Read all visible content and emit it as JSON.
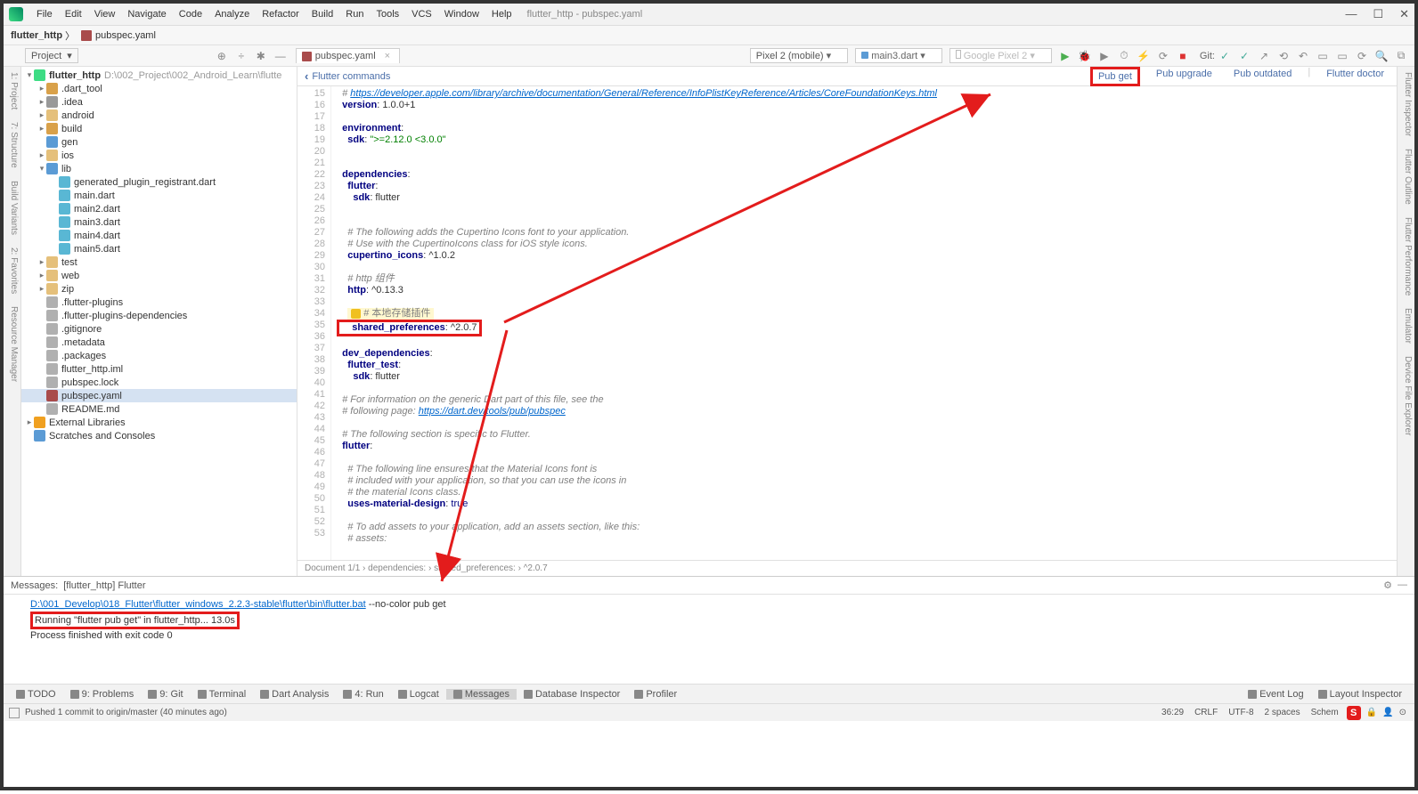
{
  "window": {
    "doc_title": "flutter_http - pubspec.yaml"
  },
  "menu": [
    "File",
    "Edit",
    "View",
    "Navigate",
    "Code",
    "Analyze",
    "Refactor",
    "Build",
    "Run",
    "Tools",
    "VCS",
    "Window",
    "Help"
  ],
  "breadcrumbs": {
    "root": "flutter_http",
    "file": "pubspec.yaml"
  },
  "toolbar": {
    "project_label": "Project",
    "device": "Pixel 2 (mobile)",
    "config": "main3.dart",
    "device2": "Google Pixel 2",
    "git_label": "Git:"
  },
  "left_rail": [
    "1: Project",
    "7: Structure",
    "Build Variants",
    "2: Favorites",
    "Resource Manager"
  ],
  "right_rail": [
    "Flutter Inspector",
    "Flutter Outline",
    "Flutter Performance",
    "Emulator",
    "Device File Explorer"
  ],
  "tree": {
    "root": {
      "name": "flutter_http",
      "path": "D:\\002_Project\\002_Android_Learn\\flutte"
    },
    "items": [
      {
        "d": 1,
        "e": "▸",
        "ic": "ic-folder-o",
        "name": ".dart_tool"
      },
      {
        "d": 1,
        "e": "▸",
        "ic": "ic-folder-g",
        "name": ".idea"
      },
      {
        "d": 1,
        "e": "▸",
        "ic": "ic-folder",
        "name": "android"
      },
      {
        "d": 1,
        "e": "▸",
        "ic": "ic-folder-o",
        "name": "build"
      },
      {
        "d": 1,
        "e": "",
        "ic": "ic-folder-b",
        "name": "gen"
      },
      {
        "d": 1,
        "e": "▸",
        "ic": "ic-folder",
        "name": "ios"
      },
      {
        "d": 1,
        "e": "▾",
        "ic": "ic-folder-b",
        "name": "lib"
      },
      {
        "d": 2,
        "e": "",
        "ic": "ic-dart",
        "name": "generated_plugin_registrant.dart"
      },
      {
        "d": 2,
        "e": "",
        "ic": "ic-dart",
        "name": "main.dart"
      },
      {
        "d": 2,
        "e": "",
        "ic": "ic-dart",
        "name": "main2.dart"
      },
      {
        "d": 2,
        "e": "",
        "ic": "ic-dart",
        "name": "main3.dart"
      },
      {
        "d": 2,
        "e": "",
        "ic": "ic-dart",
        "name": "main4.dart"
      },
      {
        "d": 2,
        "e": "",
        "ic": "ic-dart",
        "name": "main5.dart"
      },
      {
        "d": 1,
        "e": "▸",
        "ic": "ic-folder",
        "name": "test"
      },
      {
        "d": 1,
        "e": "▸",
        "ic": "ic-folder",
        "name": "web"
      },
      {
        "d": 1,
        "e": "▸",
        "ic": "ic-folder",
        "name": "zip"
      },
      {
        "d": 1,
        "e": "",
        "ic": "ic-file",
        "name": ".flutter-plugins"
      },
      {
        "d": 1,
        "e": "",
        "ic": "ic-file",
        "name": ".flutter-plugins-dependencies"
      },
      {
        "d": 1,
        "e": "",
        "ic": "ic-file",
        "name": ".gitignore"
      },
      {
        "d": 1,
        "e": "",
        "ic": "ic-file",
        "name": ".metadata"
      },
      {
        "d": 1,
        "e": "",
        "ic": "ic-file",
        "name": ".packages"
      },
      {
        "d": 1,
        "e": "",
        "ic": "ic-file",
        "name": "flutter_http.iml"
      },
      {
        "d": 1,
        "e": "",
        "ic": "ic-file",
        "name": "pubspec.lock"
      },
      {
        "d": 1,
        "e": "",
        "ic": "ic-yaml",
        "name": "pubspec.yaml",
        "sel": true
      },
      {
        "d": 1,
        "e": "",
        "ic": "ic-file",
        "name": "README.md"
      }
    ],
    "ext": "External Libraries",
    "scratch": "Scratches and Consoles"
  },
  "tab": {
    "label": "pubspec.yaml"
  },
  "flutter_commands": {
    "label": "Flutter commands",
    "cmds": [
      "Pub get",
      "Pub upgrade",
      "Pub outdated",
      "Flutter doctor"
    ]
  },
  "code": {
    "first_line": 15,
    "lines": [
      {
        "t": "  # ",
        "url": "https://developer.apple.com/library/archive/documentation/General/Reference/InfoPlistKeyReference/Articles/CoreFoundationKeys.html",
        "cls": "c-cmt"
      },
      {
        "t": "  version: 1.0.0+1",
        "key": "version",
        "val": ": 1.0.0+1"
      },
      {
        "t": ""
      },
      {
        "key": "environment",
        "val": ":"
      },
      {
        "t": "    sdk: \">=2.12.0 <3.0.0\"",
        "key": "sdk",
        "str": "\">=2.12.0 <3.0.0\""
      },
      {
        "t": ""
      },
      {
        "t": ""
      },
      {
        "key": "dependencies",
        "val": ":"
      },
      {
        "t": "    flutter:",
        "key": "flutter",
        "val": ":"
      },
      {
        "t": "      sdk: flutter",
        "key": "sdk",
        "val": ": flutter"
      },
      {
        "t": ""
      },
      {
        "t": ""
      },
      {
        "cmt": "    # The following adds the Cupertino Icons font to your application."
      },
      {
        "cmt": "    # Use with the CupertinoIcons class for iOS style icons."
      },
      {
        "t": "    cupertino_icons: ^1.0.2",
        "key": "cupertino_icons",
        "val": ": ^1.0.2"
      },
      {
        "t": ""
      },
      {
        "cmt": "    # http 组件"
      },
      {
        "t": "    http: ^0.13.3",
        "key": "http",
        "val": ": ^0.13.3"
      },
      {
        "t": ""
      },
      {
        "hlcmt": "# 本地存储插件",
        "warn": true
      },
      {
        "hlred": "    shared_preferences: ^2.0.7",
        "key": "shared_preferences",
        "val": ": ^2.0.7"
      },
      {
        "t": ""
      },
      {
        "key": "dev_dependencies",
        "val": ":"
      },
      {
        "t": "    flutter_test:",
        "key": "flutter_test",
        "val": ":"
      },
      {
        "t": "      sdk: flutter",
        "key": "sdk",
        "val": ": flutter"
      },
      {
        "t": ""
      },
      {
        "cmt": "  # For information on the generic Dart part of this file, see the"
      },
      {
        "cmt2": "  # following page: ",
        "url": "https://dart.dev/tools/pub/pubspec"
      },
      {
        "t": ""
      },
      {
        "cmt": "  # The following section is specific to Flutter."
      },
      {
        "key": "flutter",
        "val": ":"
      },
      {
        "t": ""
      },
      {
        "cmt": "    # The following line ensures that the Material Icons font is"
      },
      {
        "cmt": "    # included with your application, so that you can use the icons in"
      },
      {
        "cmt": "    # the material Icons class."
      },
      {
        "t": "    uses-material-design: true",
        "key": "uses-material-design",
        "bool": "true"
      },
      {
        "t": ""
      },
      {
        "cmt": "    # To add assets to your application, add an assets section, like this:"
      },
      {
        "cmt": "    # assets:"
      }
    ],
    "breadcrumb": "Document 1/1 › dependencies: › shared_preferences: › ^2.0.7"
  },
  "messages": {
    "title": "Messages:",
    "tabs": [
      "[flutter_http] Flutter"
    ],
    "cmdpath": "D:\\001_Develop\\018_Flutter\\flutter_windows_2.2.3-stable\\flutter\\bin\\flutter.bat",
    "cmdargs": " --no-color pub get",
    "running": "Running \"flutter pub get\" in flutter_http...",
    "duration": "13.0s",
    "done": "Process finished with exit code 0"
  },
  "bottom": [
    "TODO",
    "9: Problems",
    "9: Git",
    "Terminal",
    "Dart Analysis",
    "4: Run",
    "Logcat",
    "Messages",
    "Database Inspector",
    "Profiler"
  ],
  "bottom_right": [
    "Event Log",
    "Layout Inspector"
  ],
  "status": {
    "vcs": "Pushed 1 commit to origin/master (40 minutes ago)",
    "pos": "36:29",
    "lf": "CRLF",
    "enc": "UTF-8",
    "indent": "2 spaces",
    "schema": "Schem"
  }
}
